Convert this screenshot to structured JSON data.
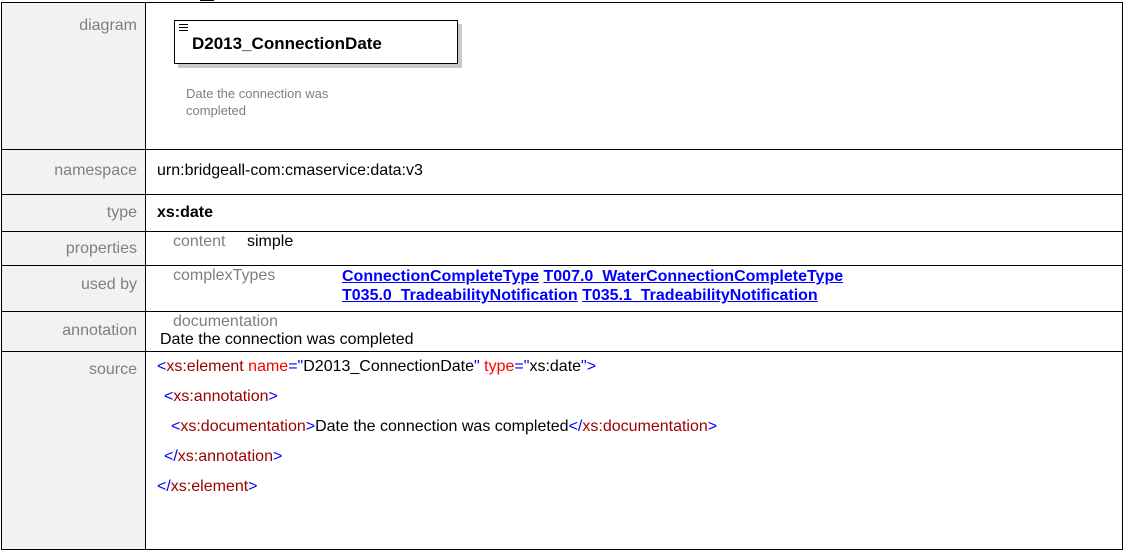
{
  "labels": {
    "diagram": "diagram",
    "namespace": "namespace",
    "type": "type",
    "properties": "properties",
    "used_by": "used by",
    "annotation": "annotation",
    "source": "source"
  },
  "diagram": {
    "element_name": "D2013_ConnectionDate",
    "doc_line1": "Date the connection was",
    "doc_line2": "completed"
  },
  "namespace": "urn:bridgeall-com:cmaservice:data:v3",
  "type": "xs:date",
  "properties": {
    "key": "content",
    "value": "simple"
  },
  "used_by": {
    "key": "complexTypes",
    "links": [
      "ConnectionCompleteType",
      "T007.0_WaterConnectionCompleteType",
      "T035.0_TradeabilityNotification",
      "T035.1_TradeabilityNotification"
    ]
  },
  "annotation": {
    "key": "documentation",
    "text": "Date the connection was completed"
  },
  "source": {
    "element_tag": "xs:element",
    "name_attr": "name",
    "name_value": "D2013_ConnectionDate",
    "type_attr": "type",
    "type_value": "xs:date",
    "annotation_tag": "xs:annotation",
    "documentation_tag": "xs:documentation",
    "documentation_text": "Date the connection was completed"
  }
}
